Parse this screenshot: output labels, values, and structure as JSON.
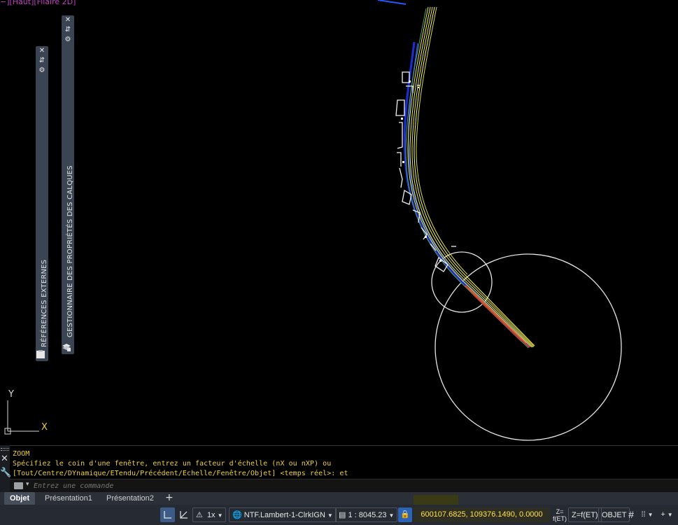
{
  "viewport": {
    "label": "−][Haut][Filaire 2D]",
    "ucs": {
      "x_label": "X",
      "y_label": "Y"
    }
  },
  "palettes": {
    "external_references": {
      "title": "RÉFÉRENCES EXTERNES"
    },
    "layer_properties": {
      "title": "GESTIONNAIRE DES PROPRIÉTÉS DES CALQUES"
    }
  },
  "command": {
    "history": [
      "ZOOM",
      "Spécifiez le coin d'une fenêtre, entrez un facteur d'échelle (nX ou nXP) ou",
      "[Tout/Centre/DYnamique/ETendu/Précédent/Echelle/Fenêtre/Objet] <temps réel>: et"
    ],
    "input_placeholder": "Entrez une commande"
  },
  "layout_tabs": {
    "tabs": [
      {
        "label": "Objet",
        "active": true
      },
      {
        "label": "Présentation1",
        "active": false
      },
      {
        "label": "Présentation2",
        "active": false
      }
    ],
    "add_label": "+"
  },
  "statusbar": {
    "annotation_scale": "1x",
    "coordinate_system": "NTF.Lambert-1-ClrkIGN",
    "viewport_scale": "1 : 8045.23",
    "coordinates": "600107.6825, 109376.1490, 0.0000",
    "z_indicator": "Z=f(ET)",
    "object_mode": "OBJET"
  },
  "colors": {
    "command_text": "#f0d23c",
    "coordinates_text": "#ffe14c",
    "palette_bg": "#3b4453",
    "status_bg": "#262b33",
    "viewport_label": "#c040c0"
  }
}
